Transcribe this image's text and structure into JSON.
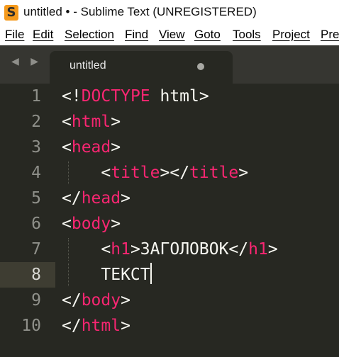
{
  "window": {
    "title": "untitled • - Sublime Text (UNREGISTERED)",
    "app_icon_glyph": "S"
  },
  "menu": [
    "File",
    "Edit",
    "Selection",
    "Find",
    "View",
    "Goto",
    "Tools",
    "Project",
    "Pre"
  ],
  "tab": {
    "label": "untitled"
  },
  "nav_arrows": "◀ ▶",
  "colors": {
    "background": "#272822",
    "tag": "#f92672",
    "text": "#f8f8f2",
    "gutter": "#8f908a",
    "current_line": "#3e3d32"
  },
  "editor": {
    "current_line": 8,
    "lines": [
      {
        "number": "1",
        "tokens": [
          {
            "t": "<!",
            "c": "punct"
          },
          {
            "t": "DOCTYPE",
            "c": "tag"
          },
          {
            "t": " html>",
            "c": "text"
          }
        ]
      },
      {
        "number": "2",
        "tokens": [
          {
            "t": "<",
            "c": "punct"
          },
          {
            "t": "html",
            "c": "tag"
          },
          {
            "t": ">",
            "c": "punct"
          }
        ]
      },
      {
        "number": "3",
        "tokens": [
          {
            "t": "<",
            "c": "punct"
          },
          {
            "t": "head",
            "c": "tag"
          },
          {
            "t": ">",
            "c": "punct"
          }
        ]
      },
      {
        "number": "4",
        "tokens": [
          {
            "t": "    <",
            "c": "punct"
          },
          {
            "t": "title",
            "c": "tag"
          },
          {
            "t": "></",
            "c": "punct"
          },
          {
            "t": "title",
            "c": "tag"
          },
          {
            "t": ">",
            "c": "punct"
          }
        ]
      },
      {
        "number": "5",
        "tokens": [
          {
            "t": "</",
            "c": "punct"
          },
          {
            "t": "head",
            "c": "tag"
          },
          {
            "t": ">",
            "c": "punct"
          }
        ]
      },
      {
        "number": "6",
        "tokens": [
          {
            "t": "<",
            "c": "punct"
          },
          {
            "t": "body",
            "c": "tag"
          },
          {
            "t": ">",
            "c": "punct"
          }
        ]
      },
      {
        "number": "7",
        "tokens": [
          {
            "t": "    <",
            "c": "punct"
          },
          {
            "t": "h1",
            "c": "tag"
          },
          {
            "t": ">ЗАГОЛОВОК</",
            "c": "text"
          },
          {
            "t": "h1",
            "c": "tag"
          },
          {
            "t": ">",
            "c": "punct"
          }
        ]
      },
      {
        "number": "8",
        "tokens": [
          {
            "t": "    ТЕКСТ",
            "c": "text"
          }
        ]
      },
      {
        "number": "9",
        "tokens": [
          {
            "t": "</",
            "c": "punct"
          },
          {
            "t": "body",
            "c": "tag"
          },
          {
            "t": ">",
            "c": "punct"
          }
        ]
      },
      {
        "number": "10",
        "tokens": [
          {
            "t": "</",
            "c": "punct"
          },
          {
            "t": "html",
            "c": "tag"
          },
          {
            "t": ">",
            "c": "punct"
          }
        ]
      }
    ]
  }
}
